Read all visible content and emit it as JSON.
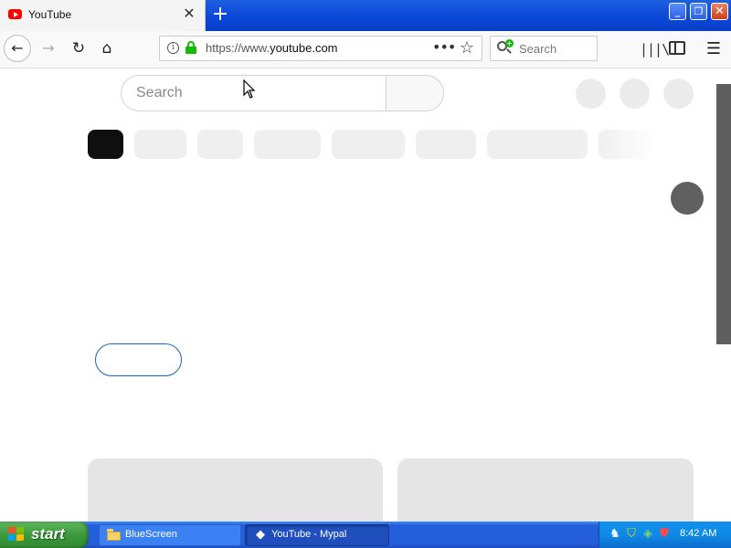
{
  "browser": {
    "tab": {
      "title": "YouTube",
      "close_symbol": "✕"
    },
    "new_tab_symbol": "+",
    "window_controls": {
      "minimize": "_",
      "maximize": "❐",
      "close": "✕"
    },
    "nav": {
      "back": "←",
      "forward": "→",
      "reload": "↻",
      "home": "⌂"
    },
    "url": {
      "scheme": "https://www.",
      "host": "youtube.com"
    },
    "page_actions": "•••",
    "bookmark": "☆",
    "search_placeholder": "Search",
    "library": "|||\\",
    "menu": "☰"
  },
  "page": {
    "search_placeholder": "Search",
    "chips_count_visible": 8
  },
  "taskbar": {
    "start_label": "start",
    "tasks": [
      {
        "label": "BlueScreen",
        "icon": "folder-icon"
      },
      {
        "label": "YouTube - Mypal",
        "icon": "mypal-icon"
      }
    ],
    "clock": "8:42 AM"
  },
  "colors": {
    "accent_blue": "#245edb",
    "lock_green": "#12bc00",
    "youtube_red": "#ff0000"
  }
}
